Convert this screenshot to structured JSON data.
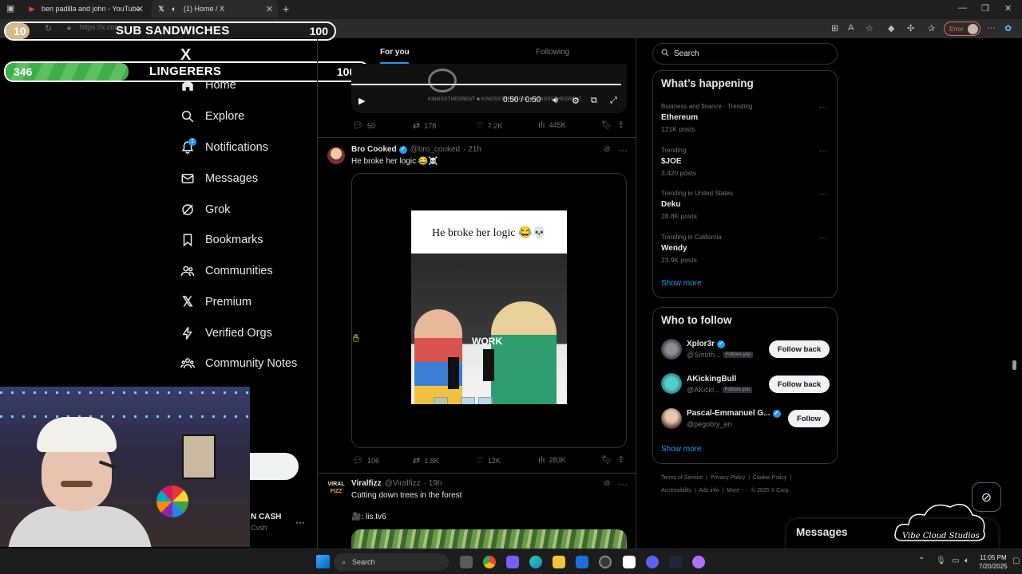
{
  "browser": {
    "tabs": [
      {
        "label": "ben padilla and john - YouTube",
        "icon": "youtube-icon"
      },
      {
        "label": "(1) Home / X",
        "icon": "x-icon"
      }
    ],
    "url": "https://x.com",
    "error_label": "Error"
  },
  "overlay": {
    "bar1": {
      "left": "10",
      "title": "SUB SANDWICHES",
      "right": "100"
    },
    "bar2": {
      "left": "346",
      "title": "LINGERERS",
      "right": "1000"
    }
  },
  "nav": {
    "logo": "X",
    "notification_count": "1",
    "items": [
      {
        "label": "Home",
        "icon": "home-icon"
      },
      {
        "label": "Explore",
        "icon": "search-icon"
      },
      {
        "label": "Notifications",
        "icon": "bell-icon"
      },
      {
        "label": "Messages",
        "icon": "envelope-icon"
      },
      {
        "label": "Grok",
        "icon": "grok-icon"
      },
      {
        "label": "Bookmarks",
        "icon": "bookmark-icon"
      },
      {
        "label": "Communities",
        "icon": "communities-icon"
      },
      {
        "label": "Premium",
        "icon": "x-icon"
      },
      {
        "label": "Verified Orgs",
        "icon": "lightning-icon"
      },
      {
        "label": "Community Notes",
        "icon": "community-notes-icon"
      }
    ],
    "account": {
      "name": "N CASH",
      "handle": "Cvsh"
    }
  },
  "timeline": {
    "tabs": [
      "For you",
      "Following"
    ],
    "video_post": {
      "time": "0:50 / 0:50",
      "watermark": "KINGSSTHEGREAT ■ KINGSSTHEGREAT ■ KINGSSTHEGREAT",
      "replies": "50",
      "reposts": "178",
      "likes": "7.2K",
      "views": "445K"
    },
    "post1": {
      "name": "Bro Cooked",
      "handle": "@bro_cooked",
      "time": "· 21h",
      "text": "He broke her logic 😂☠️",
      "media_caption": "He broke her logic 😂💀",
      "media_text": "WORK",
      "replies": "106",
      "reposts": "1.8K",
      "likes": "12K",
      "views": "283K"
    },
    "post2": {
      "name": "Viralfizz",
      "handle": "@Viralfizz",
      "time": "· 19h",
      "text": "Cutting down trees in the forest",
      "link": "🎥: lis.tv6",
      "logo_top": "VIRAL",
      "logo_bottom": "FIZZ"
    }
  },
  "sidebar": {
    "search_placeholder": "Search",
    "whats_happening": {
      "title": "What’s happening",
      "trends": [
        {
          "context": "Business and finance · Trending",
          "name": "Ethereum",
          "count": "121K posts"
        },
        {
          "context": "Trending",
          "name": "$JOE",
          "count": "3,420 posts"
        },
        {
          "context": "Trending in United States",
          "name": "Deku",
          "count": "28.8K posts"
        },
        {
          "context": "Trending in California",
          "name": "Wendy",
          "count": "23.9K posts"
        }
      ],
      "show_more": "Show more"
    },
    "who_to_follow": {
      "title": "Who to follow",
      "accounts": [
        {
          "name": "Xplor3r",
          "handle": "@Smoth...",
          "follows_you": "Follows you",
          "button": "Follow back"
        },
        {
          "name": "AKickingBull",
          "handle": "@AKickl...",
          "follows_you": "Follows you",
          "button": "Follow back"
        },
        {
          "name": "Pascal-Emmanuel G...",
          "handle": "@pegobry_en",
          "follows_you": "",
          "button": "Follow"
        }
      ],
      "show_more": "Show more"
    },
    "footer": {
      "line1": [
        "Terms of Service",
        "Privacy Policy",
        "Cookie Policy"
      ],
      "line2": [
        "Accessibility",
        "Ads info",
        "More ···",
        "© 2025 X Corp."
      ]
    },
    "messages_title": "Messages",
    "watermark": "Vibe Cloud Studios"
  },
  "taskbar": {
    "search": "Search",
    "time": "11:05 PM",
    "date": "7/20/2025"
  }
}
